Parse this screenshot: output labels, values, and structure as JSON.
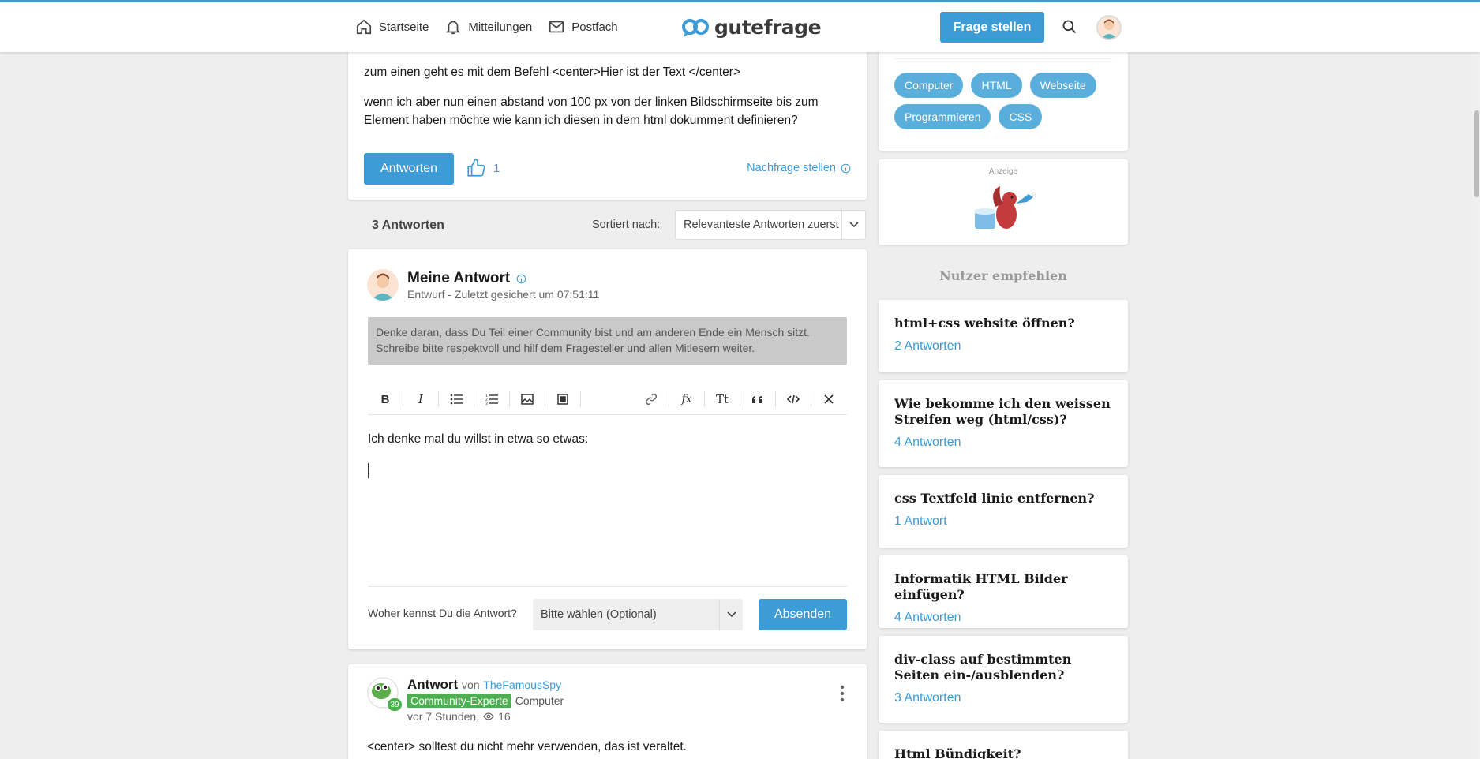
{
  "header": {
    "nav": [
      {
        "label": "Startseite",
        "icon": "home-icon"
      },
      {
        "label": "Mitteilungen",
        "icon": "bell-icon"
      },
      {
        "label": "Postfach",
        "icon": "mail-icon"
      }
    ],
    "logo_text": "gutefrage",
    "ask_button": "Frage stellen"
  },
  "question": {
    "line1": "zum einen geht es mit dem Befehl <center>Hier ist der Text </center>",
    "line2": "wenn ich aber nun einen abstand von 100 px von der linken Bildschirmseite bis zum",
    "line3": "Element haben möchte wie kann ich diesen in dem html dokumment definieren?",
    "answer_button": "Antworten",
    "likes": "1",
    "followup": "Nachfrage stellen"
  },
  "answers_bar": {
    "count": "3 Antworten",
    "sort_label": "Sortiert nach:",
    "sort_value": "Relevanteste Antworten zuerst"
  },
  "my_answer": {
    "title": "Meine Antwort",
    "subtitle": "Entwurf - Zuletzt gesichert um 07:51:11",
    "notice_line1": "Denke daran, dass Du Teil einer Community bist und am anderen Ende ein Mensch sitzt.",
    "notice_line2": "Schreibe bitte respektvoll und hilf dem Fragesteller und allen Mitlesern weiter.",
    "editor_text": "Ich denke mal du willst in etwa so etwas:",
    "source_label": "Woher kennst Du die Antwort?",
    "source_value": "Bitte wählen (Optional)",
    "submit": "Absenden",
    "toolbar": {
      "formula": "fx",
      "text_size": "Tt"
    }
  },
  "other_answer": {
    "title": "Antwort",
    "von": "von",
    "user": "TheFamousSpy",
    "level": "39",
    "badge": "Community-Experte",
    "topic": "Computer",
    "time": "vor 7 Stunden,",
    "views": "16",
    "text": "<center> solltest du nicht mehr verwenden, das ist veraltet."
  },
  "tags": [
    "Computer",
    "HTML",
    "Webseite",
    "Programmieren",
    "CSS"
  ],
  "ad": {
    "label": "Anzeige"
  },
  "recommend": {
    "title": "Nutzer empfehlen",
    "items": [
      {
        "q": "html+css website öffnen?",
        "a": "2 Antworten"
      },
      {
        "q": "Wie bekomme ich den weissen Streifen weg (html/css)?",
        "a": "4 Antworten"
      },
      {
        "q": "css Textfeld linie entfernen?",
        "a": "1 Antwort"
      },
      {
        "q": "Informatik HTML Bilder einfügen?",
        "a": "4 Antworten"
      },
      {
        "q": "div-class auf bestimmten Seiten ein-/ausblenden?",
        "a": "3 Antworten"
      },
      {
        "q": "Html Bündigkeit?",
        "a": ""
      }
    ]
  },
  "colors": {
    "accent": "#3d9bd6",
    "expert": "#4caf50"
  }
}
